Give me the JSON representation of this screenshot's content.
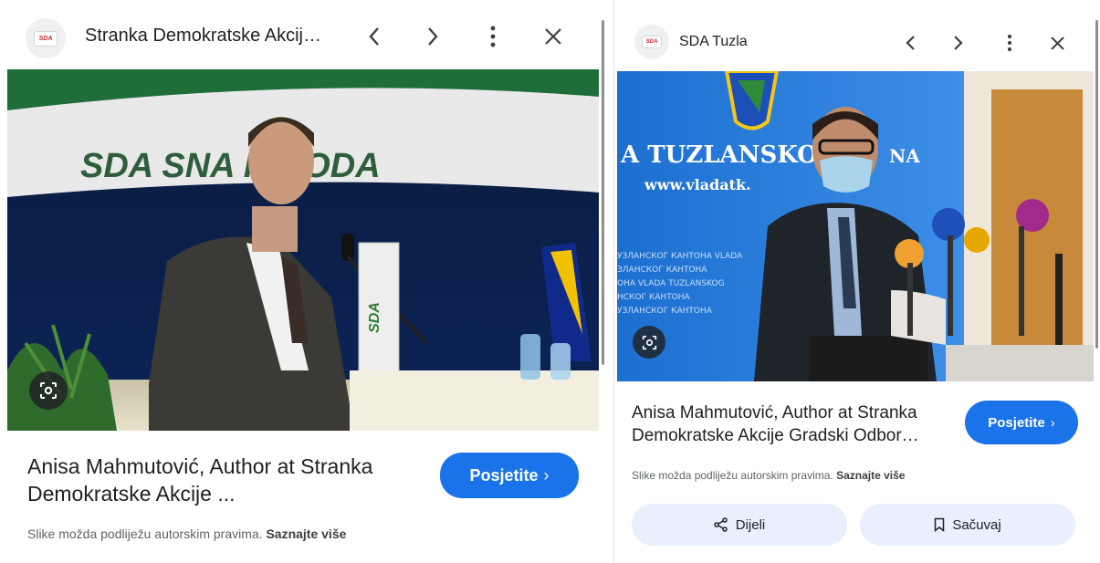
{
  "left_card": {
    "site_name": "Stranka Demokratske Akcij…",
    "logo_text": "SDA",
    "photo": {
      "banner_text": "SDA SNA   IARODA",
      "podium_label": "SDA"
    },
    "caption": "Anisa Mahmutović, Author at Stranka Demokratske Akcije ...",
    "visit_label": "Posjetite",
    "copyright_note": "Slike možda podliježu autorskim pravima.",
    "learn_more_label": "Saznajte više"
  },
  "right_card": {
    "site_name": "SDA Tuzla",
    "logo_text": "SDA",
    "photo": {
      "wall_line1": "A TUZLANSKOG",
      "wall_line1b": "NA",
      "wall_line2": "www.vladatk.",
      "cyrillic_lines": [
        "УЗЛАНСКОГ КАНТОНА VLADA",
        "ЗЛАНСКОГ КАНТОНА",
        "ОНА VLADA TUZLANSKOG",
        "НСКОГ КАНТОНА",
        "УЗЛАНСКОГ КАНТОНА"
      ]
    },
    "caption": "Anisa Mahmutović, Author at Stranka Demokratske Akcije Gradski Odbor…",
    "visit_label": "Posjetite",
    "copyright_note": "Slike možda podliježu autorskim pravima.",
    "learn_more_label": "Saznajte više",
    "share_label": "Dijeli",
    "save_label": "Sačuvaj"
  },
  "colors": {
    "accent": "#1a73e8",
    "pill_bg": "#e8f0fe",
    "logo_red": "#c62828"
  },
  "icons": [
    "back-icon",
    "forward-icon",
    "more-vert-icon",
    "close-icon",
    "lens-icon",
    "share-icon",
    "bookmark-icon"
  ]
}
